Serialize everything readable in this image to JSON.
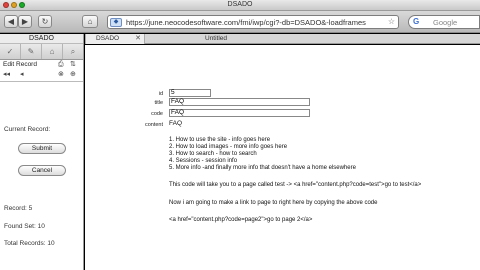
{
  "window": {
    "title": "DSADO"
  },
  "toolbar": {
    "back": "◀",
    "forward": "▶",
    "reload": "↻",
    "home": "⌂",
    "url": "https://june.neocodesoftware.com/fmi/iwp/cgi?-db=DSADO&-loadframes",
    "bookmark_star": "☆",
    "search_engine": "G",
    "search_placeholder": "Google"
  },
  "sidebar": {
    "title": "DSADO",
    "tools": [
      "✓",
      "✎",
      "⌂",
      "⌕"
    ],
    "edit_record": "Edit Record",
    "current_record_label": "Current Record:",
    "submit": "Submit",
    "cancel": "Cancel",
    "record": "Record: 5",
    "found_set": "Found Set: 10",
    "total_records": "Total Records: 10"
  },
  "tabs": [
    {
      "label": "DSADO"
    },
    {
      "label": "Untitled"
    }
  ],
  "form": {
    "fields": [
      {
        "label": "id",
        "value": "5"
      },
      {
        "label": "title",
        "value": "FAQ"
      },
      {
        "label": "code",
        "value": "FAQ"
      },
      {
        "label": "content",
        "value": "FAQ"
      }
    ],
    "content_lines": [
      "1. How to use the site - info goes here",
      "2. How to load images - more info goes here",
      "3. How to search - how to search",
      "4. Sessions - session info",
      "5. More info -and finally more info that doesn't have a home elsewhere",
      "This code will take you to a page called test -> <a href=\"content.php?code=test\">go to test</a>",
      "Now i am going to make a link to page to right here by copying the above code",
      "<a href=\"content.php?code=page2\">go to page 2</a>"
    ]
  },
  "colors": {
    "accent": "#3d6fd6",
    "chrome": "#c9c9c9"
  }
}
